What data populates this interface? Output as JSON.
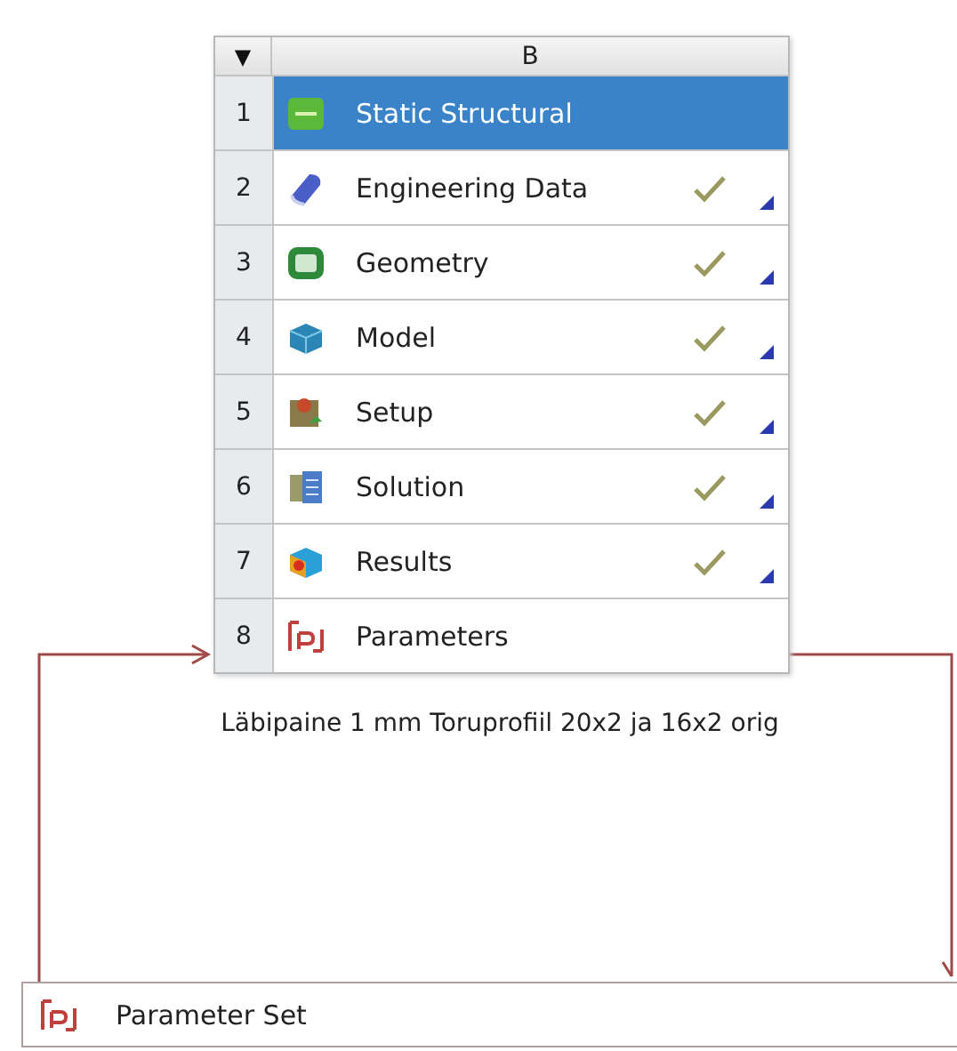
{
  "system": {
    "menu_glyph": "▼",
    "column": "B",
    "rows": [
      {
        "number": "1",
        "label": "Static Structural",
        "kind": "static_structural",
        "selected": true,
        "checked": false,
        "menu": false
      },
      {
        "number": "2",
        "label": "Engineering Data",
        "kind": "engineering_data",
        "selected": false,
        "checked": true,
        "menu": true
      },
      {
        "number": "3",
        "label": "Geometry",
        "kind": "geometry",
        "selected": false,
        "checked": true,
        "menu": true
      },
      {
        "number": "4",
        "label": "Model",
        "kind": "model",
        "selected": false,
        "checked": true,
        "menu": true
      },
      {
        "number": "5",
        "label": "Setup",
        "kind": "setup",
        "selected": false,
        "checked": true,
        "menu": true
      },
      {
        "number": "6",
        "label": "Solution",
        "kind": "solution",
        "selected": false,
        "checked": true,
        "menu": true
      },
      {
        "number": "7",
        "label": "Results",
        "kind": "results",
        "selected": false,
        "checked": true,
        "menu": true
      },
      {
        "number": "8",
        "label": "Parameters",
        "kind": "parameters",
        "selected": false,
        "checked": false,
        "menu": false
      }
    ],
    "caption": "Läbipaine 1 mm Toruprofiil 20x2 ja 16x2 orig"
  },
  "parameter_set": {
    "label": "Parameter Set"
  }
}
